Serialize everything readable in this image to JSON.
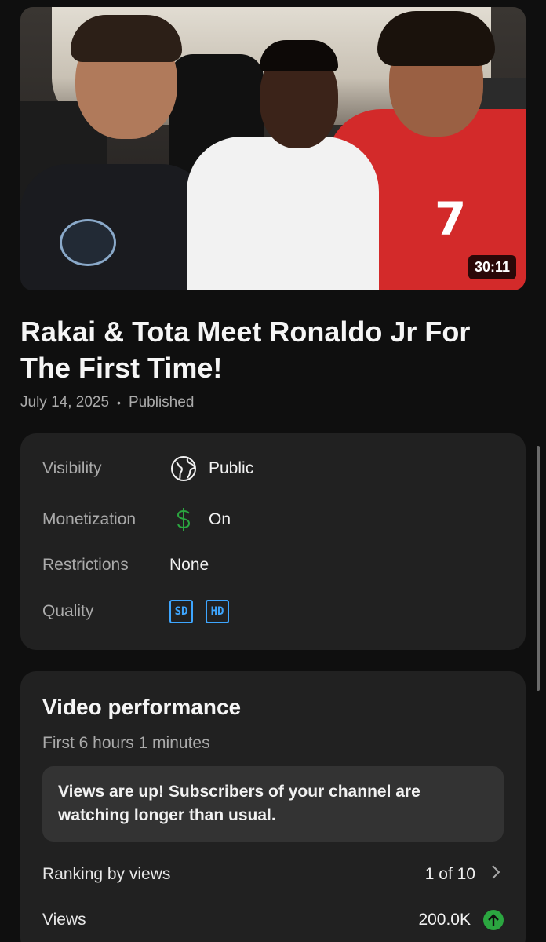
{
  "video": {
    "duration": "30:11",
    "title": "Rakai & Tota Meet Ronaldo Jr For The First Time!",
    "date": "July 14, 2025",
    "separator": "•",
    "status": "Published"
  },
  "details": {
    "visibility": {
      "label": "Visibility",
      "value": "Public",
      "icon": "globe-icon"
    },
    "monetization": {
      "label": "Monetization",
      "value": "On",
      "icon": "dollar-icon",
      "icon_color": "#2ba640"
    },
    "restrictions": {
      "label": "Restrictions",
      "value": "None"
    },
    "quality": {
      "label": "Quality",
      "badges": [
        "SD",
        "HD"
      ],
      "badge_color": "#3ea6ff"
    }
  },
  "performance": {
    "title": "Video performance",
    "subtitle": "First 6 hours 1 minutes",
    "notice": "Views are up! Subscribers of your channel are watching longer than usual.",
    "ranking": {
      "label": "Ranking by views",
      "value": "1 of 10"
    },
    "views": {
      "label": "Views",
      "value": "200.0K",
      "trend": "up",
      "trend_color": "#2ba640"
    }
  },
  "thumbnail_text": {
    "jersey_number": "7"
  }
}
